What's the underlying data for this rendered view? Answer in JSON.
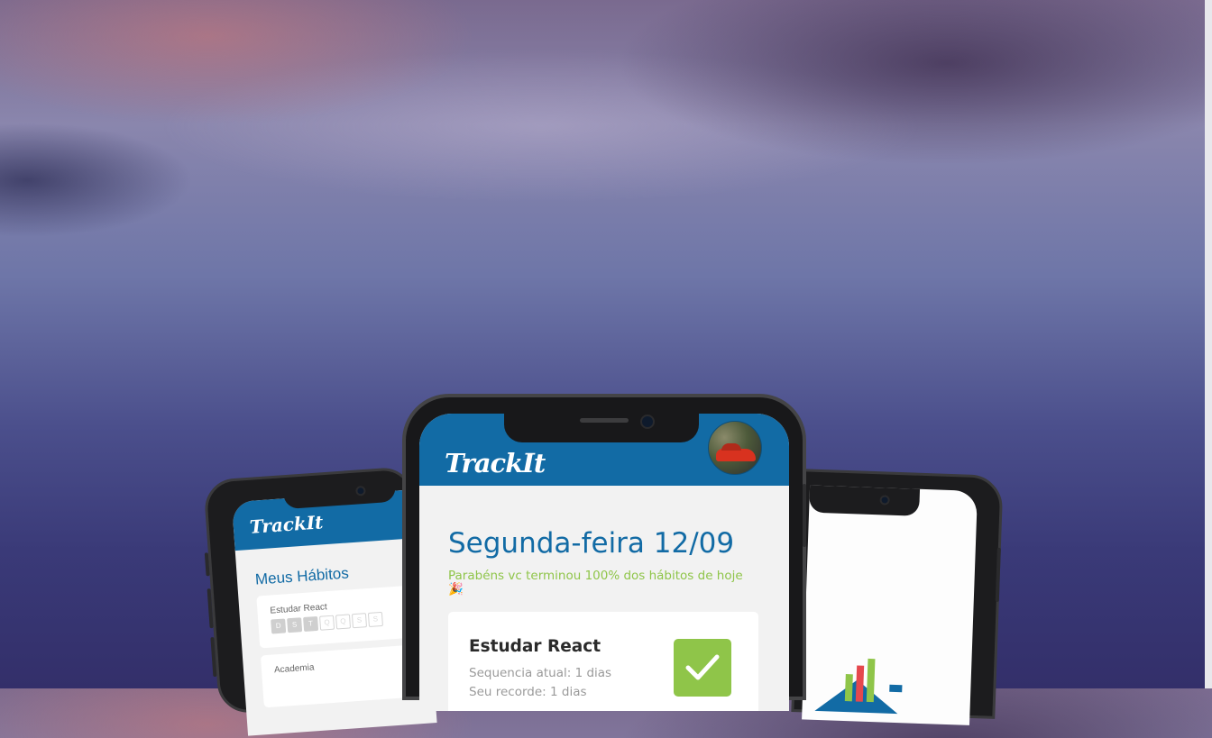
{
  "app": {
    "logo_text": "TrackIt"
  },
  "left_phone": {
    "title": "Meus Hábitos",
    "habits": [
      {
        "name": "Estudar React",
        "days": [
          "D",
          "S",
          "T",
          "Q",
          "Q",
          "S",
          "S"
        ],
        "selected": [
          true,
          true,
          true,
          false,
          false,
          false,
          false
        ]
      },
      {
        "name": "Academia"
      }
    ]
  },
  "center_phone": {
    "date_title": "Segunda-feira 12/09",
    "progress_message": "Parabéns vc terminou 100% dos hábitos de hoje 🎉",
    "habit": {
      "name": "Estudar React",
      "streak_text": "Sequencia atual: 1 dias",
      "record_text": "Seu recorde: 1 dias",
      "done": true
    }
  },
  "colors": {
    "brand_blue": "#126BA5",
    "success_green": "#8FC549",
    "background": "#F2F2F2"
  }
}
